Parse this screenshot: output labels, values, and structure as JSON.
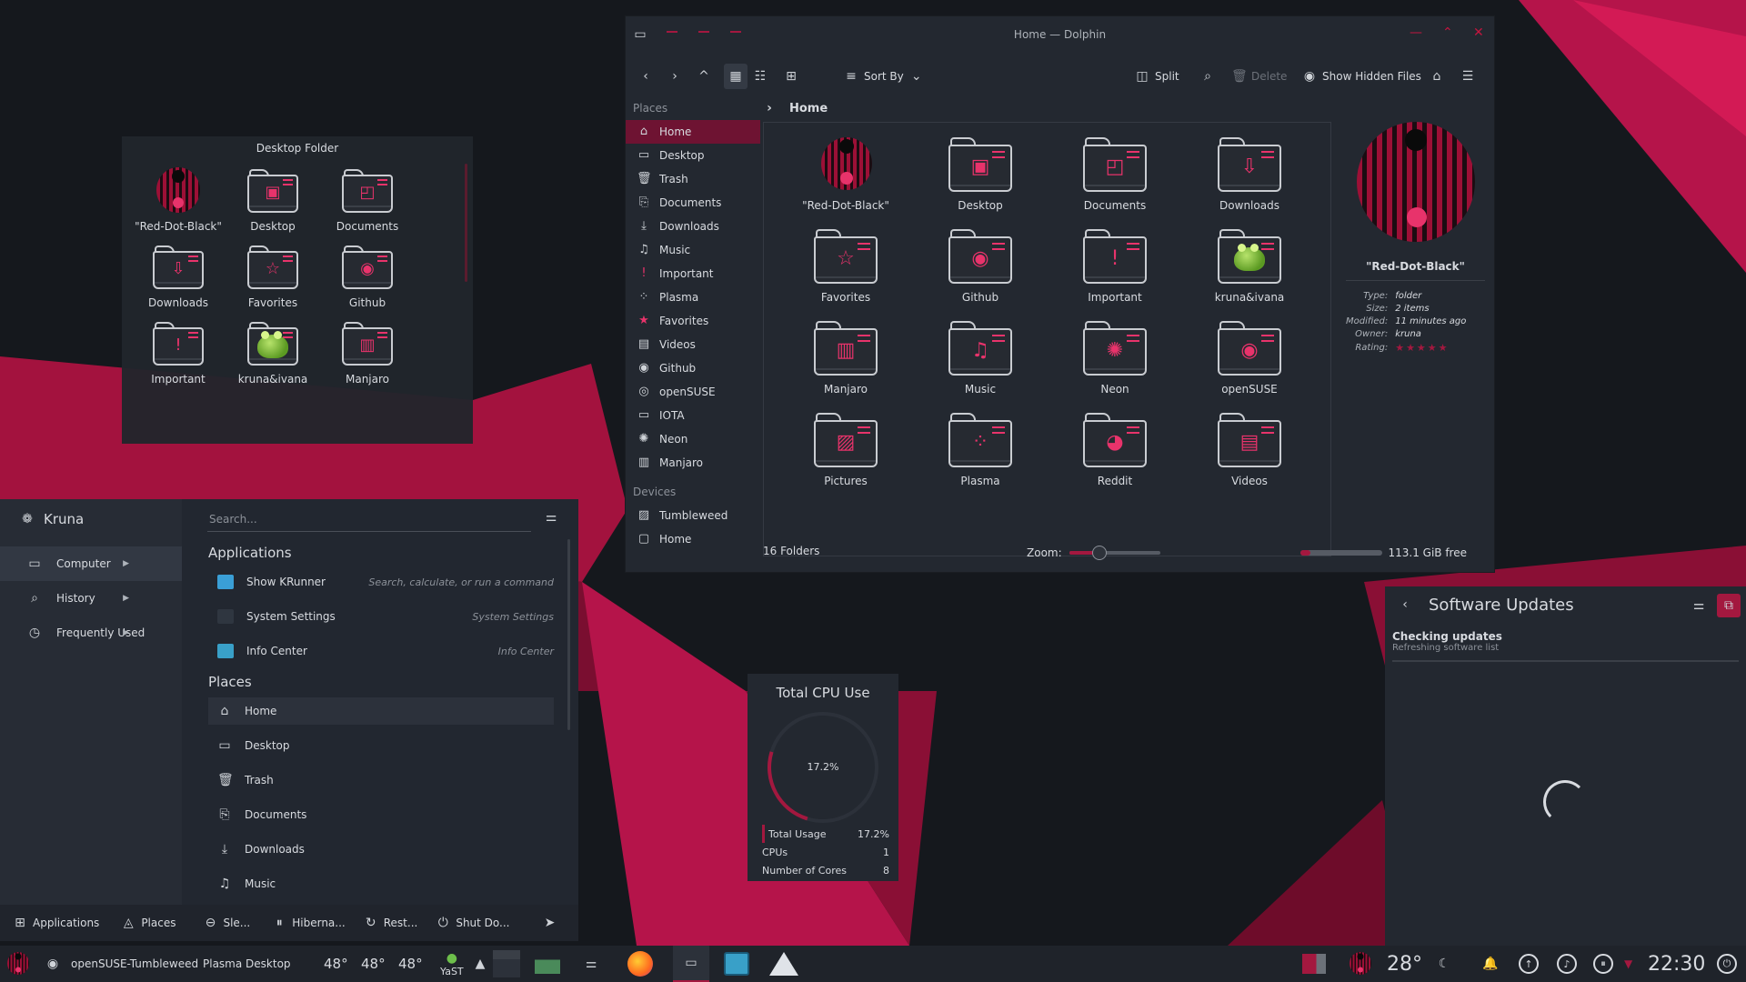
{
  "desktop_folder": {
    "title": "Desktop Folder",
    "items": [
      {
        "label": "\"Red-Dot-Black\"",
        "icon": "red-dot-icon"
      },
      {
        "label": "Desktop",
        "icon": "desktop-folder-icon",
        "emblem": "▣"
      },
      {
        "label": "Documents",
        "icon": "documents-folder-icon",
        "emblem": "◰"
      },
      {
        "label": "Downloads",
        "icon": "downloads-folder-icon",
        "emblem": "⇩"
      },
      {
        "label": "Favorites",
        "icon": "favorites-folder-icon",
        "emblem": "☆"
      },
      {
        "label": "Github",
        "icon": "github-folder-icon",
        "emblem": "◉"
      },
      {
        "label": "Important",
        "icon": "important-folder-icon",
        "emblem": "!"
      },
      {
        "label": "kruna&ivana",
        "icon": "frog-folder-icon"
      },
      {
        "label": "Manjaro",
        "icon": "manjaro-folder-icon",
        "emblem": "▥"
      }
    ]
  },
  "dolphin": {
    "window_title": "Home — Dolphin",
    "toolbar": {
      "sort_by": "Sort By",
      "split": "Split",
      "delete": "Delete",
      "show_hidden": "Show Hidden Files"
    },
    "places_header": "Places",
    "places": [
      {
        "label": "Home",
        "icon": "home-icon",
        "glyph": "⌂"
      },
      {
        "label": "Desktop",
        "icon": "desktop-icon",
        "glyph": "▭"
      },
      {
        "label": "Trash",
        "icon": "trash-icon",
        "glyph": "🗑"
      },
      {
        "label": "Documents",
        "icon": "documents-icon",
        "glyph": "⎘"
      },
      {
        "label": "Downloads",
        "icon": "downloads-icon",
        "glyph": "⤓"
      },
      {
        "label": "Music",
        "icon": "music-icon",
        "glyph": "♫"
      },
      {
        "label": "Important",
        "icon": "important-icon",
        "glyph": "!"
      },
      {
        "label": "Plasma",
        "icon": "plasma-icon",
        "glyph": "⁘"
      },
      {
        "label": "Favorites",
        "icon": "favorites-icon",
        "glyph": "★"
      },
      {
        "label": "Videos",
        "icon": "videos-icon",
        "glyph": "▤"
      },
      {
        "label": "Github",
        "icon": "github-icon",
        "glyph": "◉"
      },
      {
        "label": "openSUSE",
        "icon": "opensuse-icon",
        "glyph": "◎"
      },
      {
        "label": "IOTA",
        "icon": "folder-icon",
        "glyph": "▭"
      },
      {
        "label": "Neon",
        "icon": "neon-icon",
        "glyph": "✺"
      },
      {
        "label": "Manjaro",
        "icon": "manjaro-icon",
        "glyph": "▥"
      }
    ],
    "devices_header": "Devices",
    "devices": [
      {
        "label": "Tumbleweed",
        "icon": "drive-icon",
        "glyph": "▨"
      },
      {
        "label": "Home",
        "icon": "drive-icon",
        "glyph": "▢"
      }
    ],
    "breadcrumb": "Home",
    "files": [
      {
        "label": "\"Red-Dot-Black\"",
        "icon": "red-dot-icon"
      },
      {
        "label": "Desktop",
        "icon": "desktop-folder-icon",
        "emblem": "▣"
      },
      {
        "label": "Documents",
        "icon": "documents-folder-icon",
        "emblem": "◰"
      },
      {
        "label": "Downloads",
        "icon": "downloads-folder-icon",
        "emblem": "⇩"
      },
      {
        "label": "Favorites",
        "icon": "favorites-folder-icon",
        "emblem": "☆"
      },
      {
        "label": "Github",
        "icon": "github-folder-icon",
        "emblem": "◉"
      },
      {
        "label": "Important",
        "icon": "important-folder-icon",
        "emblem": "!"
      },
      {
        "label": "kruna&ivana",
        "icon": "frog-folder-icon"
      },
      {
        "label": "Manjaro",
        "icon": "manjaro-folder-icon",
        "emblem": "▥"
      },
      {
        "label": "Music",
        "icon": "music-folder-icon",
        "emblem": "♫"
      },
      {
        "label": "Neon",
        "icon": "neon-folder-icon",
        "emblem": "✺"
      },
      {
        "label": "openSUSE",
        "icon": "opensuse-folder-icon",
        "emblem": "◉"
      },
      {
        "label": "Pictures",
        "icon": "pictures-folder-icon",
        "emblem": "▨"
      },
      {
        "label": "Plasma",
        "icon": "plasma-folder-icon",
        "emblem": "⁘"
      },
      {
        "label": "Reddit",
        "icon": "reddit-folder-icon",
        "emblem": "◕"
      },
      {
        "label": "Videos",
        "icon": "videos-folder-icon",
        "emblem": "▤"
      }
    ],
    "info": {
      "name": "\"Red-Dot-Black\"",
      "rows": [
        {
          "k": "Type:",
          "v": "folder"
        },
        {
          "k": "Size:",
          "v": "2 items"
        },
        {
          "k": "Modified:",
          "v": "11 minutes ago"
        },
        {
          "k": "Owner:",
          "v": "kruna"
        },
        {
          "k": "Rating:",
          "v": ""
        }
      ]
    },
    "status": {
      "count": "16 Folders",
      "zoom_label": "Zoom:",
      "free": "113.1 GiB free",
      "zoom_level": 0.33,
      "used_fraction": 0.12
    }
  },
  "appmenu": {
    "user": "Kruna",
    "search_placeholder": "Search...",
    "categories": [
      {
        "label": "Computer",
        "icon": "computer-icon",
        "glyph": "▭"
      },
      {
        "label": "History",
        "icon": "search-icon",
        "glyph": "⌕"
      },
      {
        "label": "Frequently Used",
        "icon": "clock-icon",
        "glyph": "◷"
      }
    ],
    "applications_header": "Applications",
    "applications": [
      {
        "label": "Show KRunner",
        "desc": "Search, calculate, or run a command",
        "color": "#3a9fd6"
      },
      {
        "label": "System Settings",
        "desc": "System Settings",
        "color": "#2f3640"
      },
      {
        "label": "Info Center",
        "desc": "Info Center",
        "color": "#39a0c8"
      }
    ],
    "places_header": "Places",
    "places": [
      {
        "label": "Home",
        "glyph": "⌂"
      },
      {
        "label": "Desktop",
        "glyph": "▭"
      },
      {
        "label": "Trash",
        "glyph": "🗑"
      },
      {
        "label": "Documents",
        "glyph": "⎘"
      },
      {
        "label": "Downloads",
        "glyph": "⤓"
      },
      {
        "label": "Music",
        "glyph": "♫"
      }
    ],
    "bottom": {
      "applications": "Applications",
      "places": "Places",
      "sleep": "Sle...",
      "hibernate": "Hiberna...",
      "restart": "Rest...",
      "shutdown": "Shut Do..."
    }
  },
  "cpu": {
    "title": "Total CPU Use",
    "percent_label": "17.2%",
    "percent": 17.2,
    "rows": [
      {
        "k": "Total Usage",
        "v": "17.2%"
      },
      {
        "k": "CPUs",
        "v": "1"
      },
      {
        "k": "Number of Cores",
        "v": "8"
      }
    ]
  },
  "updates": {
    "title": "Software Updates",
    "status": "Checking updates",
    "sub": "Refreshing software list"
  },
  "taskbar": {
    "distro": "openSUSE-Tumbleweed",
    "activity": "Plasma Desktop",
    "temps": [
      "48°",
      "48°",
      "48°"
    ],
    "yast": "YaST",
    "weather": "28°",
    "clock": "22:30"
  },
  "colors": {
    "accent": "#a3183f",
    "accent_bright": "#e8336b",
    "panel": "#232830"
  }
}
